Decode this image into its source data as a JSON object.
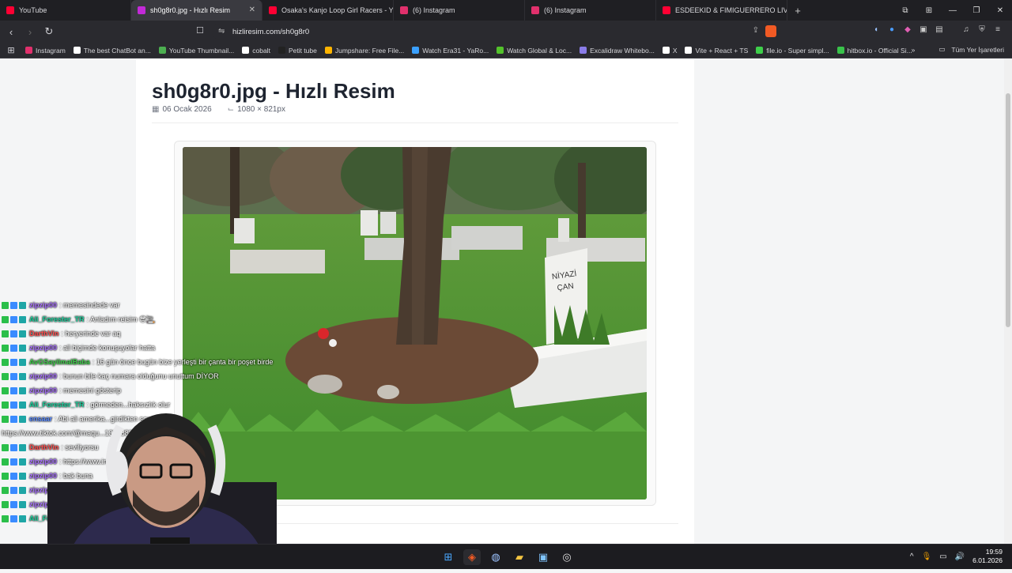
{
  "browser": {
    "tabs": [
      {
        "label": "YouTube",
        "color": "#ff0033",
        "active": false
      },
      {
        "label": "sh0g8r0.jpg - Hızlı Resim",
        "color": "#c32ad8",
        "active": true
      },
      {
        "label": "Osaka's Kanjo Loop Girl Racers - You",
        "color": "#ff0033",
        "active": false
      },
      {
        "label": "(6) Instagram",
        "color": "#e1306c",
        "active": false
      },
      {
        "label": "(6) Instagram",
        "color": "#e1306c",
        "active": false
      },
      {
        "label": "ESDEEKID & FIMIGUERRERO LIVE @",
        "color": "#ff0033",
        "active": false
      }
    ],
    "url": "hizliresim.com/sh0g8r0",
    "bookmarks": [
      {
        "label": "Instagram",
        "color": "#e1306c"
      },
      {
        "label": "The best ChatBot an...",
        "color": "#ffffff"
      },
      {
        "label": "YouTube Thumbnail...",
        "color": "#4caf50"
      },
      {
        "label": "cobalt",
        "color": "#ffffff"
      },
      {
        "label": "Petit tube",
        "color": "#222222"
      },
      {
        "label": "Jumpshare: Free File...",
        "color": "#ffb400"
      },
      {
        "label": "Watch Era31 - YaRo...",
        "color": "#3aa0ff"
      },
      {
        "label": "Watch Global & Loc...",
        "color": "#53c22b"
      },
      {
        "label": "Excalidraw Whitebo...",
        "color": "#8a7ce8"
      },
      {
        "label": "X",
        "color": "#ffffff"
      },
      {
        "label": "Vite + React + TS",
        "color": "#ffffff"
      },
      {
        "label": "file.io - Super simpl...",
        "color": "#3ecf4a"
      },
      {
        "label": "hitbox.io - Official Si...",
        "color": "#39c24a"
      }
    ],
    "all_bookmarks_label": "Tüm Yer İşaretleri"
  },
  "page": {
    "title": "sh0g8r0.jpg - Hızlı Resim",
    "date": "06 Ocak 2026",
    "dimensions": "1080 × 821px"
  },
  "chat": [
    {
      "user": "zipzip00",
      "text": ": memesindede var",
      "color": "#a970ff"
    },
    {
      "user": "Ali_Forester_TR",
      "text": ": Anladım reisim 😎🚬",
      "color": "#1ed3a0"
    },
    {
      "user": "DarthVin",
      "text": ": heryerinde var aq",
      "color": "#ff4d4d"
    },
    {
      "user": "zipzip00",
      "text": ": all biçimde konuşuyolar hatta",
      "color": "#a970ff"
    },
    {
      "user": "AvGSayilmalBaba",
      "text": ": 16 gün önce bugün bize yerleşti bir çanta bir poşet birde",
      "color": "#3ecf4a"
    },
    {
      "user": "zipzip00",
      "text": ": bunun bile kaç numara olduğunu unuttum DİYOR",
      "color": "#a970ff"
    },
    {
      "user": "zipzip00",
      "text": ": memesini gösterip",
      "color": "#a970ff"
    },
    {
      "user": "Ali_Forester_TR",
      "text": ": görmeden...haksızlık olur",
      "color": "#1ed3a0"
    },
    {
      "user": "ensaar",
      "text": ": Abi ali amerika...girdikten sonra eşgal",
      "color": "#5b8cff"
    },
    {
      "user": "",
      "text": "https://www.tiktok.com/@maqu...1396882",
      "color": "#ffffff"
    },
    {
      "user": "DarthVin",
      "text": ": seviliyorsu",
      "color": "#ff4d4d"
    },
    {
      "user": "zipzip00",
      "text": ": https://www.ins",
      "color": "#a970ff"
    },
    {
      "user": "zipzip00",
      "text": ": bak buna",
      "color": "#a970ff"
    },
    {
      "user": "zipzip00",
      "text": ": b",
      "color": "#a970ff"
    },
    {
      "user": "zipzip00",
      "text": ": u",
      "color": "#a970ff"
    },
    {
      "user": "Ali_Forester_TR",
      "text": "",
      "color": "#1ed3a0"
    }
  ],
  "taskbar": {
    "time": "19:59",
    "date": "6.01.2026"
  }
}
